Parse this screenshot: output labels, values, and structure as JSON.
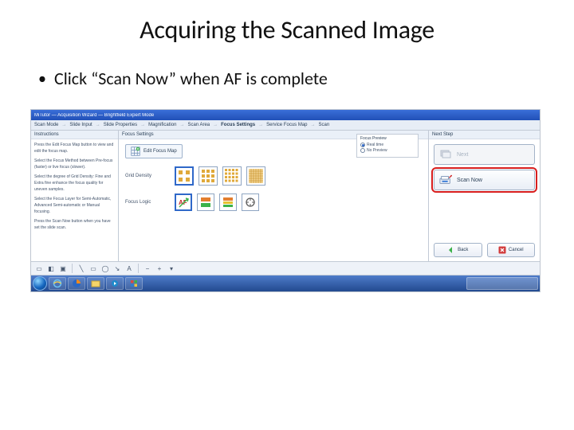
{
  "title": "Acquiring the Scanned Image",
  "bullet": "Click “Scan Now” when AF is complete",
  "window": {
    "title": "MiTutor — Acquisition Wizard — Brightfield Expert Mode",
    "steps": [
      "Scan Mode",
      "Slide Input",
      "Slide Properties",
      "Magnification",
      "Scan Area",
      "Focus Settings",
      "Service Focus Map",
      "Scan"
    ],
    "active_step_index": 5
  },
  "panels": {
    "instructions_hdr": "Instructions",
    "instructions": [
      "Press the Edit Focus Map button to view and edit the focus map.",
      "Select the Focus Method between Pre-focus (faster) or live focus (slower).",
      "Select the degree of Grid Density: Fine and Extra fine enhance the focus quality for uneven samples.",
      "Select the Focus Layer for Semi-Automatic, Advanced Semi-automatic or Manual focusing.",
      "Press the Scan Now button when you have set the slide scan."
    ],
    "focus_settings_hdr": "Focus Settings",
    "edit_focus_label": "Edit Focus Map",
    "grid_density_label": "Grid Density",
    "focus_logic_label": "Focus Logic",
    "preview": {
      "title": "Focus Preview",
      "opt_realtime": "Real time",
      "opt_noprev": "No Preview",
      "selected": 0
    },
    "next_step_hdr": "Next Step",
    "next_btn": "Next",
    "scan_now_btn": "Scan Now",
    "back_btn": "Back",
    "cancel_btn": "Cancel"
  }
}
